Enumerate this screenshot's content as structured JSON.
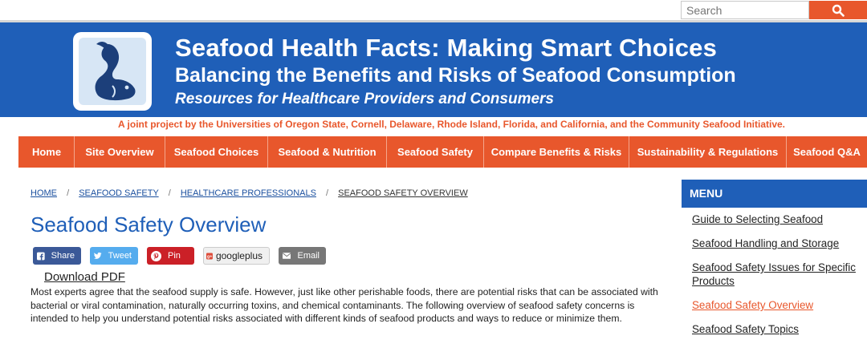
{
  "search": {
    "placeholder": "Search"
  },
  "header": {
    "title": "Seafood Health Facts: Making Smart Choices",
    "subtitle": "Balancing the Benefits and Risks of Seafood Consumption",
    "tagline": "Resources for Healthcare Providers and Consumers"
  },
  "project_line": "A joint project by the Universities of Oregon State, Cornell, Delaware, Rhode Island, Florida, and California, and the Community Seafood Initiative.",
  "nav": {
    "items": [
      {
        "label": "Home"
      },
      {
        "label": "Site Overview"
      },
      {
        "label": "Seafood Choices"
      },
      {
        "label": "Seafood & Nutrition"
      },
      {
        "label": "Seafood Safety"
      },
      {
        "label": "Compare Benefits & Risks"
      },
      {
        "label": "Sustainability & Regulations"
      },
      {
        "label": "Seafood Q&A"
      }
    ]
  },
  "breadcrumb": {
    "items": [
      "HOME",
      "SEAFOOD SAFETY",
      "HEALTHCARE PROFESSIONALS",
      "SEAFOOD SAFETY OVERVIEW"
    ],
    "separator": "/"
  },
  "page_title": "Seafood Safety Overview",
  "share": {
    "facebook": "Share",
    "twitter": "Tweet",
    "pinterest": "Pin",
    "googleplus": "googleplus",
    "email": "Email"
  },
  "download_label": "Download PDF",
  "intro_text": "Most experts agree that the seafood supply is safe. However, just like other perishable foods, there are potential risks that can be associated with bacterial or viral contamination, naturally occurring toxins, and chemical contaminants. The following overview of seafood safety concerns is intended to help you understand potential risks associated with different kinds of seafood products and ways to reduce or minimize them.",
  "menu": {
    "heading": "MENU",
    "items": [
      {
        "label": "Guide to Selecting Seafood"
      },
      {
        "label": "Seafood Handling and Storage"
      },
      {
        "label": "Seafood Safety Issues for Specific Products"
      },
      {
        "label": "Seafood Safety Overview"
      },
      {
        "label": "Seafood Safety Topics"
      }
    ]
  },
  "colors": {
    "brand_blue": "#1f5fb8",
    "accent_orange": "#e8572c"
  }
}
